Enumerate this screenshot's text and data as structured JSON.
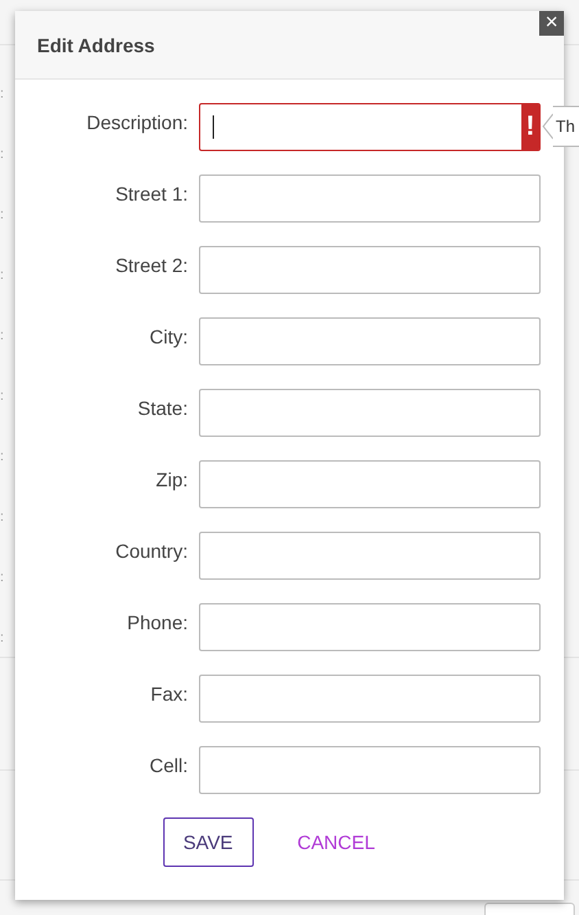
{
  "background": {
    "row_markers": [
      ":",
      ":",
      ":",
      ":",
      ":",
      ":",
      ":",
      ":",
      ":",
      ":"
    ]
  },
  "dialog": {
    "title": "Edit Address",
    "close_label": "×",
    "fields": [
      {
        "label": "Description:",
        "invalid": true,
        "focused": true
      },
      {
        "label": "Street 1:",
        "invalid": false,
        "focused": false
      },
      {
        "label": "Street 2:",
        "invalid": false,
        "focused": false
      },
      {
        "label": "City:",
        "invalid": false,
        "focused": false
      },
      {
        "label": "State:",
        "invalid": false,
        "focused": false
      },
      {
        "label": "Zip:",
        "invalid": false,
        "focused": false
      },
      {
        "label": "Country:",
        "invalid": false,
        "focused": false
      },
      {
        "label": "Phone:",
        "invalid": false,
        "focused": false
      },
      {
        "label": "Fax:",
        "invalid": false,
        "focused": false
      },
      {
        "label": "Cell:",
        "invalid": false,
        "focused": false
      }
    ],
    "error_mark": "!",
    "error_tooltip": "Th",
    "buttons": [
      {
        "label": "SAVE",
        "kind": "outlined"
      },
      {
        "label": "CANCEL",
        "kind": "text"
      }
    ]
  }
}
